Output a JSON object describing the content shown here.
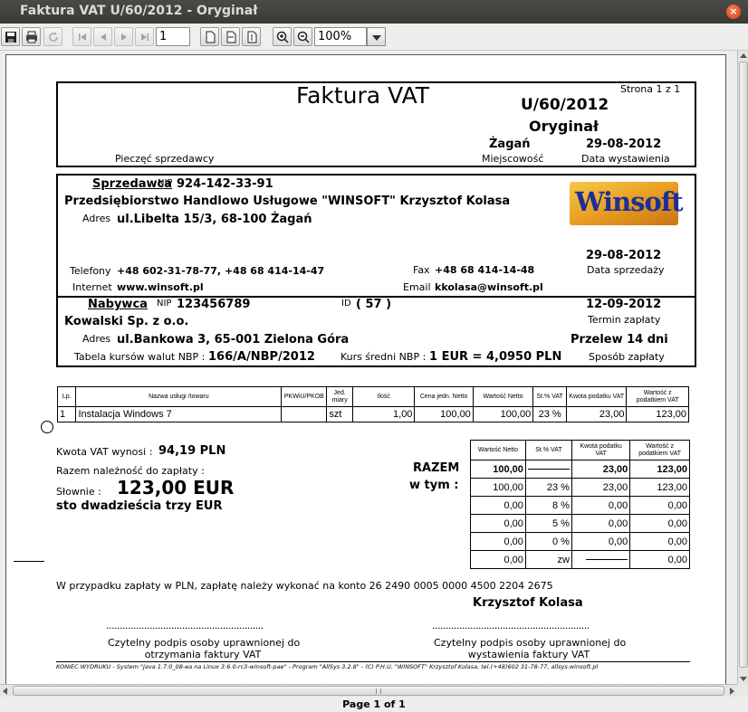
{
  "window": {
    "title": "Faktura VAT U/60/2012 - Oryginał",
    "close_glyph": "×"
  },
  "toolbar": {
    "page_input": "1",
    "zoom_value": "100%"
  },
  "status": {
    "page_label": "Page 1 of 1"
  },
  "invoice": {
    "page_of": "Strona 1 z 1",
    "heading": "Faktura VAT",
    "number": "U/60/2012",
    "copy_type": "Oryginał",
    "seller_stamp_label": "Pieczęć sprzedawcy",
    "place": "Żagań",
    "place_label": "Miejscowość",
    "issue_date": "29-08-2012",
    "issue_date_label": "Data wystawienia",
    "seller": {
      "label": "Sprzedawca",
      "nip_label": "NIP",
      "nip": "924-142-33-91",
      "name": "Przedsiębiorstwo Handlowo Usługowe \"WINSOFT\" Krzysztof Kolasa",
      "address_label": "Adres",
      "address": "ul.Libelta 15/3, 68-100 Żagań",
      "logo_text": "Winsoft",
      "sale_date": "29-08-2012",
      "sale_date_label": "Data sprzedaży",
      "phone_label": "Telefony",
      "phones": "+48 602-31-78-77, +48 68 414-14-47",
      "fax_label": "Fax",
      "fax": "+48 68 414-14-48",
      "internet_label": "Internet",
      "internet": "www.winsoft.pl",
      "email_label": "Email",
      "email": "kkolasa@winsoft.pl"
    },
    "buyer": {
      "label": "Nabywca",
      "nip_label": "NIP",
      "nip": "123456789",
      "id_label": "ID",
      "id": "( 57 )",
      "name": "Kowalski Sp. z o.o.",
      "address_label": "Adres",
      "address": "ul.Bankowa 3, 65-001 Zielona Góra",
      "due_date": "12-09-2012",
      "due_date_label": "Termin zapłaty",
      "payment": "Przelew 14 dni",
      "payment_label": "Sposób zapłaty",
      "nbp_table_label": "Tabela kursów walut NBP :",
      "nbp_table": "166/A/NBP/2012",
      "rate_label": "Kurs średni NBP :",
      "rate": "1 EUR = 4,0950 PLN"
    },
    "items_headers": [
      "Lp.",
      "Nazwa usługi /towaru",
      "PKWiU/PKOB",
      "Jed. miary",
      "Ilość",
      "Cena jedn. Netto",
      "Wartość Netto",
      "St.% VAT",
      "Kwota podatku VAT",
      "Wartość z podatkiem VAT"
    ],
    "items": [
      [
        "1",
        "Instalacja Windows 7",
        "",
        "szt",
        "1,00",
        "100,00",
        "100,00",
        "23 %",
        "23,00",
        "123,00"
      ]
    ],
    "vat_amount_label": "Kwota VAT wynosi :",
    "vat_amount": "94,19 PLN",
    "total_due_label": "Razem należność do zapłaty :",
    "words_label": "Słownie :",
    "total_due": "123,00 EUR",
    "total_words": "sto dwadzieścia trzy EUR",
    "razem_label": "RAZEM",
    "w_tym_label": "w tym :",
    "summary_headers": [
      "Wartość Netto",
      "St.% VAT",
      "Kwota podatku VAT",
      "Wartość z podatkiem VAT"
    ],
    "summary_total": [
      "100,00",
      "",
      "23,00",
      "123,00"
    ],
    "summary_rows": [
      [
        "100,00",
        "23 %",
        "23,00",
        "123,00"
      ],
      [
        "0,00",
        "8 %",
        "0,00",
        "0,00"
      ],
      [
        "0,00",
        "5 %",
        "0,00",
        "0,00"
      ],
      [
        "0,00",
        "0 %",
        "0,00",
        "0,00"
      ],
      [
        "0,00",
        "zw",
        "",
        "0,00"
      ]
    ],
    "bank_note": "W przypadku zapłaty w PLN, zapłatę należy wykonać na konto 26 2490 0005 0000 4500 2204 2675",
    "issuer_name": "Krzysztof Kolasa",
    "signature_dots": "..........................................................",
    "sig_left": [
      "Czytelny podpis osoby uprawnionej do",
      "otrzymania faktury VAT"
    ],
    "sig_right": [
      "Czytelny podpis osoby uprawnionej do",
      "wystawienia faktury VAT"
    ],
    "footer": "KONIEC WYDRUKU - System \"Java 1.7.0_08-ea na Linux 3.6.0-rc3-winsoft-pae\" - Program \"AllSys 3.2.8\" - (C) P.H.U. \"WINSOFT\" Krzysztof Kolasa, tel.(+48)602 31-78-77, allsys.winsoft.pl"
  }
}
